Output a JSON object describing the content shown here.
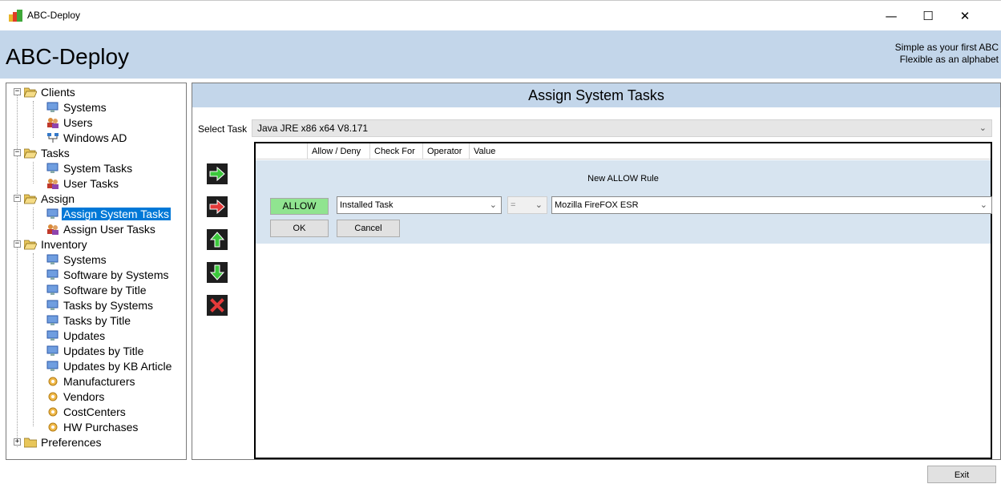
{
  "window": {
    "title": "ABC-Deploy",
    "minimize": "—",
    "maximize": "☐",
    "close": "✕"
  },
  "banner": {
    "app_name": "ABC-Deploy",
    "slogan_line1": "Simple as your first ABC",
    "slogan_line2": "Flexible as an alphabet"
  },
  "tree": {
    "clients": "Clients",
    "clients_systems": "Systems",
    "clients_users": "Users",
    "clients_windows_ad": "Windows AD",
    "tasks": "Tasks",
    "tasks_system": "System Tasks",
    "tasks_user": "User Tasks",
    "assign": "Assign",
    "assign_system": "Assign System Tasks",
    "assign_user": "Assign User Tasks",
    "inventory": "Inventory",
    "inv_systems": "Systems",
    "inv_software_by_systems": "Software by Systems",
    "inv_software_by_title": "Software by Title",
    "inv_tasks_by_systems": "Tasks by Systems",
    "inv_tasks_by_title": "Tasks by Title",
    "inv_updates": "Updates",
    "inv_updates_by_title": "Updates by Title",
    "inv_updates_by_kb": "Updates by KB Article",
    "inv_manufacturers": "Manufacturers",
    "inv_vendors": "Vendors",
    "inv_costcenters": "CostCenters",
    "inv_hw_purchases": "HW Purchases",
    "preferences": "Preferences"
  },
  "main": {
    "header": "Assign System Tasks",
    "select_task_label": "Select Task",
    "selected_task": "Java JRE x86 x64 V8.171",
    "columns": [
      "Allow / Deny",
      "Check For",
      "Operator",
      "Value"
    ],
    "rule_title": "New ALLOW Rule",
    "allow_label": "ALLOW",
    "check_for": "Installed Task",
    "operator": "=",
    "value": "Mozilla FireFOX ESR",
    "ok_label": "OK",
    "cancel_label": "Cancel"
  },
  "exit_label": "Exit",
  "colors": {
    "banner": "#c3d6ea",
    "selection": "#0078d7",
    "allow_green": "#90e490",
    "rule_panel": "#d7e4f0"
  }
}
